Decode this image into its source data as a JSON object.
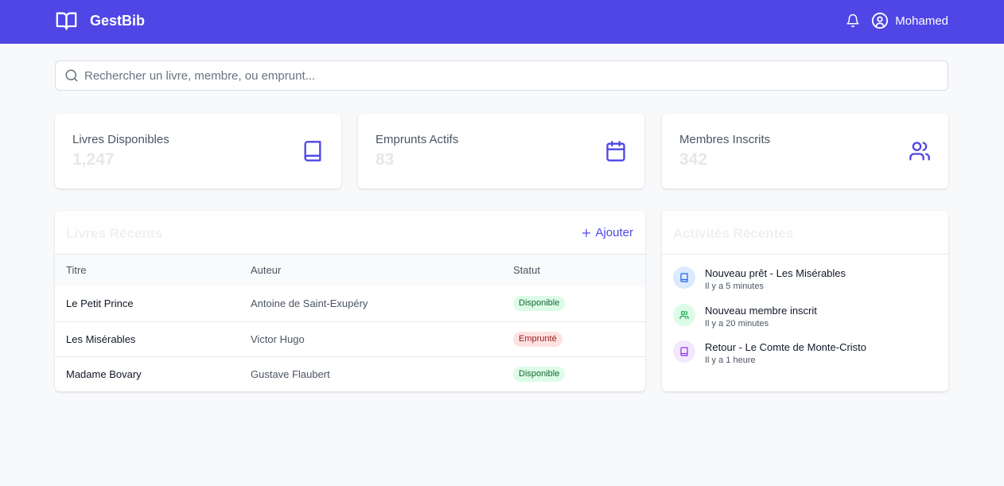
{
  "app": {
    "name": "GestBib"
  },
  "user": {
    "name": "Mohamed"
  },
  "search": {
    "placeholder": "Rechercher un livre, membre, ou emprunt..."
  },
  "stats": [
    {
      "label": "Livres Disponibles",
      "value": "1,247",
      "icon": "book-icon"
    },
    {
      "label": "Emprunts Actifs",
      "value": "83",
      "icon": "calendar-icon"
    },
    {
      "label": "Membres Inscrits",
      "value": "342",
      "icon": "users-icon"
    }
  ],
  "books": {
    "title": "Livres Récents",
    "add_label": "Ajouter",
    "columns": [
      "Titre",
      "Auteur",
      "Statut"
    ],
    "rows": [
      {
        "title": "Le Petit Prince",
        "author": "Antoine de Saint-Exupéry",
        "status": "Disponible"
      },
      {
        "title": "Les Misérables",
        "author": "Victor Hugo",
        "status": "Emprunté"
      },
      {
        "title": "Madame Bovary",
        "author": "Gustave Flaubert",
        "status": "Disponible"
      }
    ]
  },
  "activities": {
    "title": "Activités Récentes",
    "items": [
      {
        "text": "Nouveau prêt - Les Misérables",
        "time": "Il y a 5 minutes",
        "icon": "book-icon"
      },
      {
        "text": "Nouveau membre inscrit",
        "time": "Il y a 20 minutes",
        "icon": "users-icon"
      },
      {
        "text": "Retour - Le Comte de Monte-Cristo",
        "time": "Il y a 1 heure",
        "icon": "book-icon"
      }
    ]
  },
  "colors": {
    "primary": "#4f46e5",
    "available_bg": "#dcfce7",
    "available_text": "#166534",
    "borrowed_bg": "#fee2e2",
    "borrowed_text": "#991b1b"
  }
}
